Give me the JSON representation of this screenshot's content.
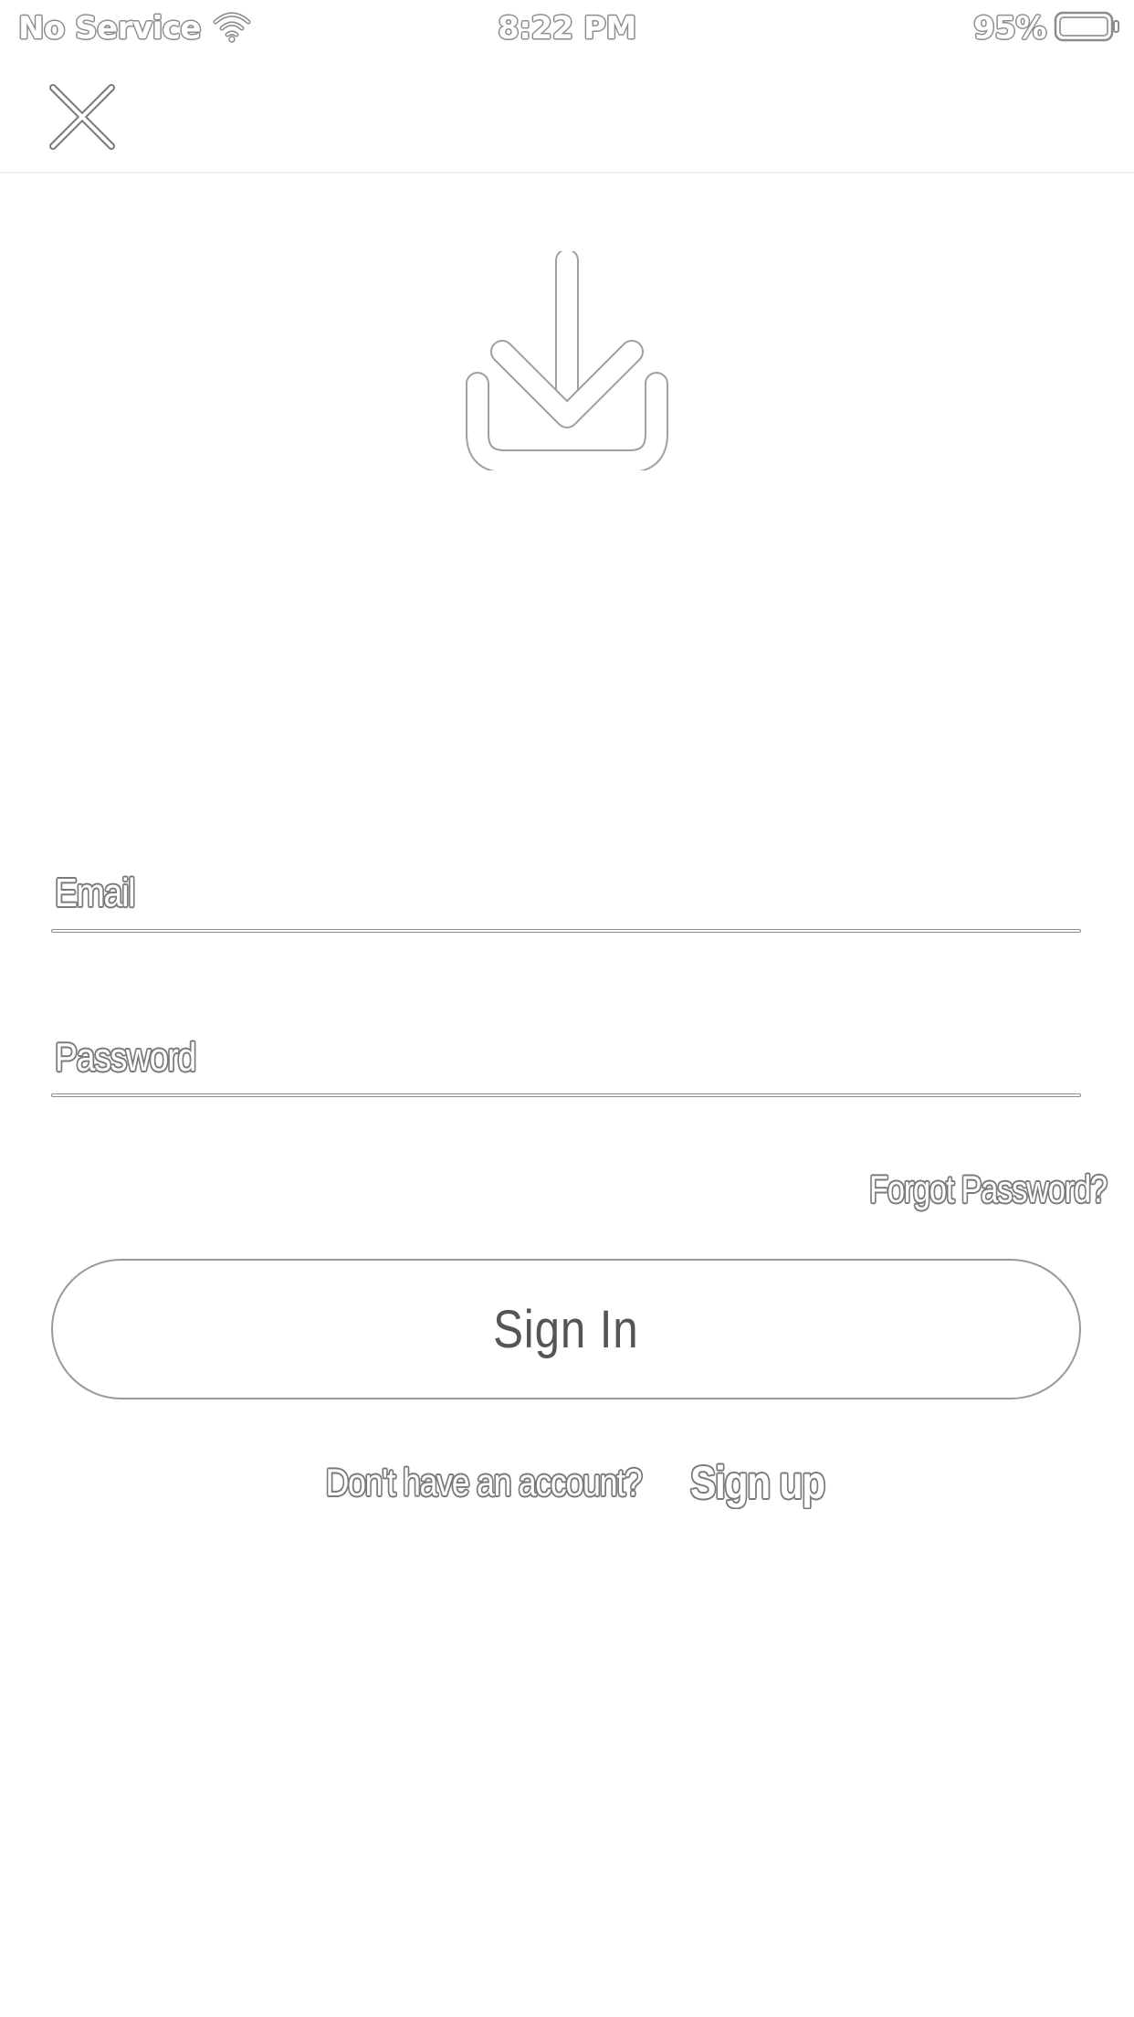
{
  "status_bar": {
    "carrier": "No Service",
    "time": "8:22 PM",
    "battery_percent": "95%",
    "icons": [
      "wifi-icon",
      "battery-icon"
    ]
  },
  "nav": {
    "close_icon": "close-icon"
  },
  "logo": {
    "icon": "download-tray-icon"
  },
  "form": {
    "email_placeholder": "Email",
    "password_placeholder": "Password",
    "forgot_password": "Forgot Password?",
    "sign_in": "Sign In",
    "signup_prompt": "Don't have an account?",
    "signup_link": "Sign up"
  },
  "colors": {
    "background": "#ffffff",
    "outline": "#7a7a7a",
    "button_border": "#9a9a9a",
    "button_text": "#555555",
    "divider": "#ededed"
  }
}
